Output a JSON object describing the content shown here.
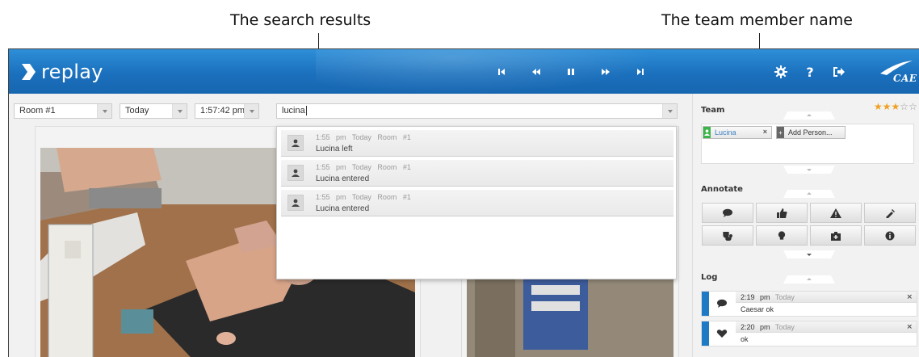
{
  "callouts": {
    "search_results": "The search results",
    "team_member_name": "The team member name"
  },
  "header": {
    "logo_text": "replay",
    "brand": "CAE",
    "transport": [
      "skip-to-start-icon",
      "rewind-icon",
      "pause-icon",
      "fast-forward-icon",
      "skip-to-end-icon"
    ],
    "icons": [
      "gear-icon",
      "help-icon",
      "logout-icon"
    ],
    "help_glyph": "?"
  },
  "toolbar": {
    "room_select": "Room #1",
    "day_select": "Today",
    "time_select": "1:57:42 pm",
    "search_value": "lucina"
  },
  "search_results": [
    {
      "time": "1:55 pm",
      "day": "Today",
      "room": "Room #1",
      "message": "Lucina left"
    },
    {
      "time": "1:55 pm",
      "day": "Today",
      "room": "Room #1",
      "message": "Lucina entered"
    },
    {
      "time": "1:55 pm",
      "day": "Today",
      "room": "Room #1",
      "message": "Lucina entered"
    }
  ],
  "team": {
    "title": "Team",
    "rating": 3,
    "rating_max": 5,
    "members": [
      {
        "name": "Lucina",
        "remove": "×"
      }
    ],
    "add_person_label": "Add Person..."
  },
  "annotate": {
    "title": "Annotate",
    "buttons": [
      "comment-icon",
      "thumbs-up-icon",
      "warning-icon",
      "syringe-icon",
      "stethoscope-icon",
      "lightbulb-icon",
      "first-aid-kit-icon",
      "info-icon"
    ]
  },
  "log": {
    "title": "Log",
    "entries": [
      {
        "time": "2:19 pm",
        "day": "Today",
        "text": "Caesar ok",
        "icon": "comment-icon",
        "remove": "×"
      },
      {
        "time": "2:20 pm",
        "day": "Today",
        "text": "ok",
        "icon": "heart-icon",
        "remove": "×"
      }
    ]
  },
  "colors": {
    "header_blue": "#1b70bd",
    "accent_blue": "#1f7ac6",
    "star_gold": "#f0a020",
    "member_green": "#3bb54a"
  }
}
